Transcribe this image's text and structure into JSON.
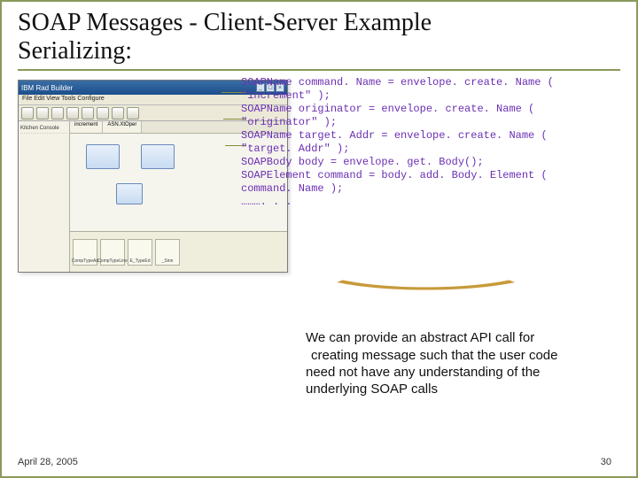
{
  "title_line1": "SOAP Messages - Client-Server Example",
  "title_line2": "Serializing:",
  "code_lines": "SOAPName command. Name = envelope. create. Name (\n\"increment\" );\nSOAPName originator = envelope. create. Name (\n\"originator\" );\nSOAPName target. Addr = envelope. create. Name (\n\"target. Addr\" );\nSOAPBody body = envelope. get. Body();\nSOAPElement command = body. add. Body. Element (\ncommand. Name );\n………. . .",
  "body_text_l1": "We can provide an abstract API call for",
  "body_text_l2": " creating message such that the user code",
  "body_text_l3": "need not have any understanding of the",
  "body_text_l4": "underlying SOAP calls",
  "footer_date": "April 28, 2005",
  "footer_page": "30",
  "screenshot": {
    "window_title": "IBM  Rad Builder",
    "menu": "File  Edit  View  Tools  Configure",
    "left_items": [
      "Kitchen Console"
    ],
    "tabs": [
      "increment",
      "ASN.XtOper"
    ],
    "bottom_items": [
      "CompTypeAd",
      "CompTypeLine",
      "E_TypeEd",
      "_Sinn"
    ]
  }
}
